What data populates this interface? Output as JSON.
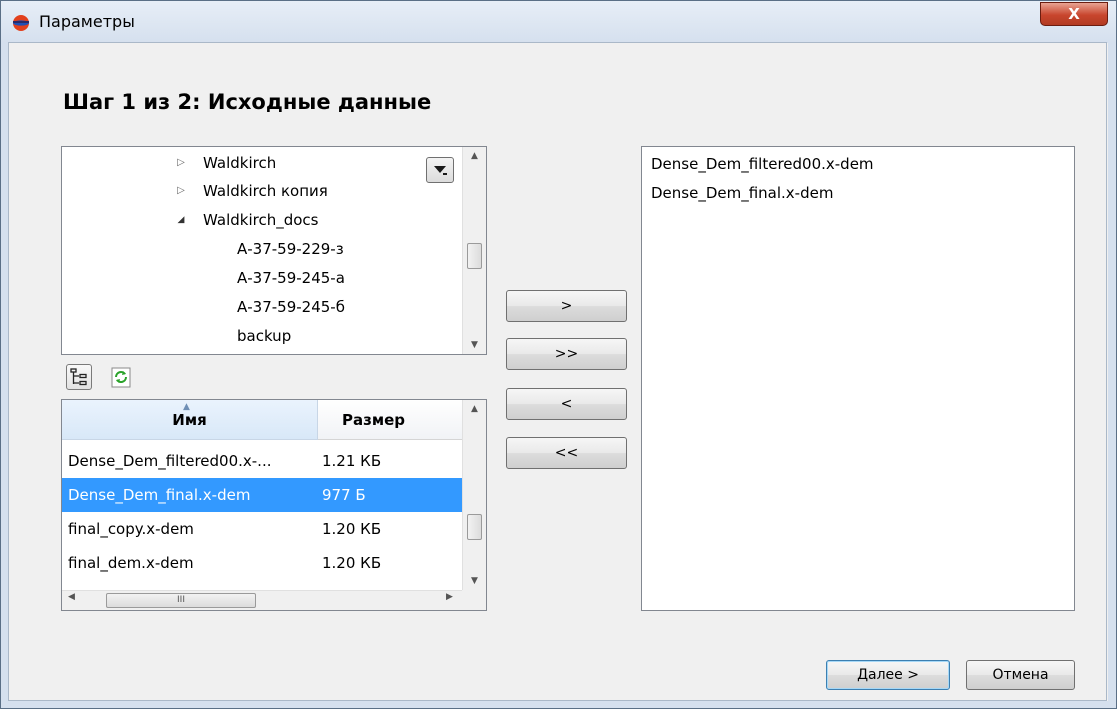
{
  "window": {
    "title": "Параметры",
    "close_glyph": "X"
  },
  "step_title": "Шаг 1 из 2: Исходные данные",
  "tree": {
    "items": [
      {
        "label": "Waldkirch",
        "expander": "collapsed"
      },
      {
        "label": "Waldkirch копия",
        "expander": "collapsed"
      },
      {
        "label": "Waldkirch_docs",
        "expander": "expanded"
      },
      {
        "label": "А-37-59-229-з",
        "expander": "none"
      },
      {
        "label": "А-37-59-245-а",
        "expander": "none"
      },
      {
        "label": "А-37-59-245-б",
        "expander": "none"
      },
      {
        "label": "backup",
        "expander": "none"
      }
    ],
    "dropdown_icon": "dropdown-arrow-icon"
  },
  "toolbar": {
    "tree_view_icon": "tree-view-icon",
    "refresh_icon": "refresh-icon"
  },
  "file_list": {
    "columns": {
      "name": "Имя",
      "size": "Размер"
    },
    "rows": [
      {
        "name": "Dense_Dem_filtered00.x-...",
        "size": "1.21 КБ",
        "selected": false
      },
      {
        "name": "Dense_Dem_final.x-dem",
        "size": "977 Б",
        "selected": true
      },
      {
        "name": "final_copy.x-dem",
        "size": "1.20 КБ",
        "selected": false
      },
      {
        "name": "final_dem.x-dem",
        "size": "1.20 КБ",
        "selected": false
      }
    ],
    "hscroll_grip": "III"
  },
  "move_buttons": {
    "add": ">",
    "add_all": ">>",
    "remove": "<",
    "remove_all": "<<"
  },
  "selected_files": [
    "Dense_Dem_filtered00.x-dem",
    "Dense_Dem_final.x-dem"
  ],
  "buttons": {
    "next": "Далее >",
    "cancel": "Отмена"
  },
  "colors": {
    "selection": "#3399ff",
    "header_active": "#d8e8f8",
    "title_bar": "#d5e0ee",
    "close": "#c8462e"
  }
}
